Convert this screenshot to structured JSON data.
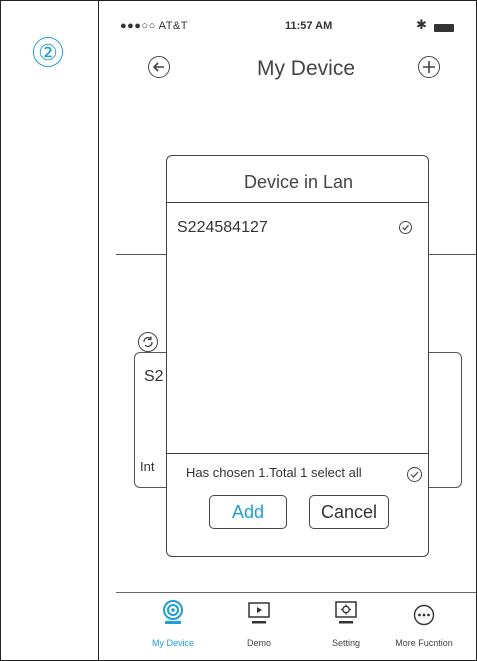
{
  "step_marker": "②",
  "status_bar": {
    "carrier": "●●●○○ AT&T",
    "time": "11:57 AM",
    "bluetooth": "✱"
  },
  "header": {
    "title": "My Device",
    "back_icon": "arrow-left-circle-icon",
    "add_icon": "plus-circle-icon"
  },
  "background": {
    "card_label": "S2",
    "card_status": "Int"
  },
  "dialog": {
    "title": "Device in Lan",
    "devices": [
      {
        "id": "S224584127",
        "selected": true
      }
    ],
    "summary": "Has chosen 1.Total 1  select all",
    "select_all_checked": true,
    "add_label": "Add",
    "cancel_label": "Cancel"
  },
  "tabs": [
    {
      "label": "My Device",
      "icon": "camera-icon",
      "active": true
    },
    {
      "label": "Demo",
      "icon": "play-icon",
      "active": false
    },
    {
      "label": "Setting",
      "icon": "gear-icon",
      "active": false
    },
    {
      "label": "More Fucntion",
      "icon": "more-icon",
      "active": false
    }
  ],
  "colors": {
    "accent": "#1e9fd8",
    "outline": "#444444"
  }
}
